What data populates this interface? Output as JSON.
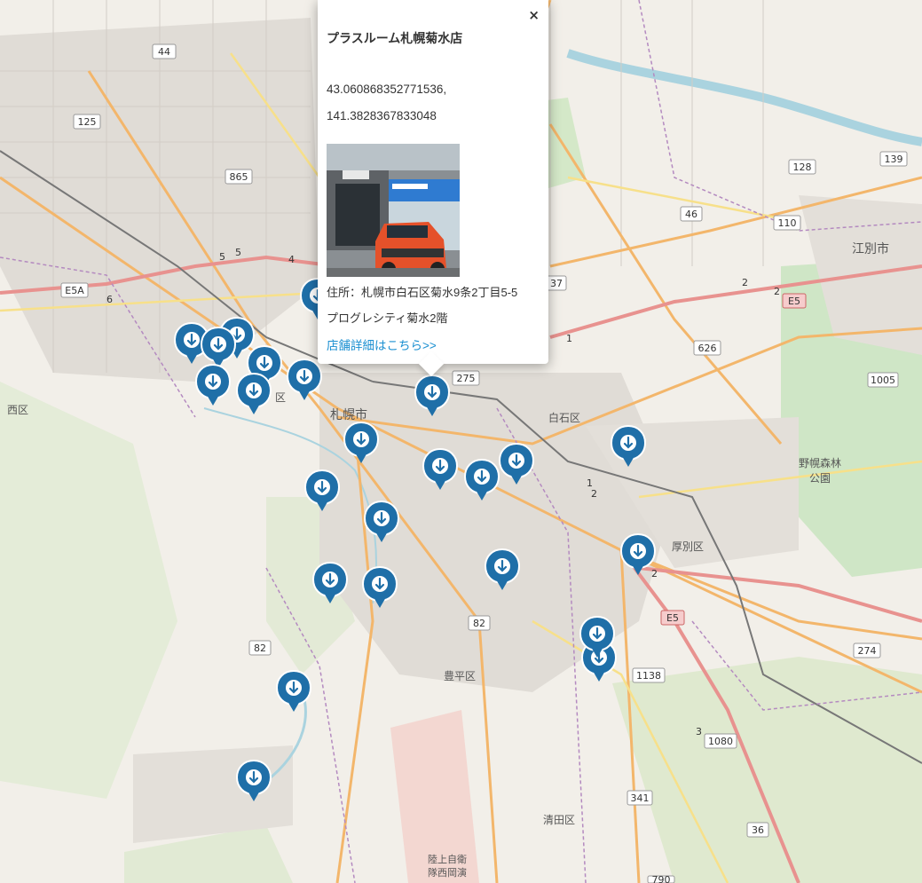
{
  "popup": {
    "title": "プラスルーム札幌菊水店",
    "lat": "43.060868352771536,",
    "lng": "141.3828367833048",
    "address_line1": "住所：札幌市白石区菊水9条2丁目5-5",
    "address_line2": "プログレシティ菊水2階",
    "link_text": "店舗詳細はこちら>>",
    "close_label": "×"
  },
  "map_labels": {
    "sapporo": "札幌市",
    "shiroishi": "白石区",
    "nishi": "西区",
    "ebetsu": "江別市",
    "nopporo1": "野幌森林",
    "nopporo2": "公園",
    "atsubetsu": "厚別区",
    "toyohira": "豊平区",
    "kiyota": "清田区",
    "jsdf1": "陸上自衛",
    "jsdf2": "隊西岡演",
    "chuo_partial": "区"
  },
  "road_shields": [
    "44",
    "125",
    "865",
    "E5A",
    "275",
    "82",
    "82",
    "626",
    "46",
    "110",
    "128",
    "139",
    "1005",
    "E5",
    "E5",
    "274",
    "1138",
    "1080",
    "341",
    "36",
    "37",
    "790"
  ],
  "road_numbers": [
    "5",
    "5",
    "4",
    "6",
    "2",
    "2",
    "1",
    "2",
    "3",
    "2",
    "1"
  ],
  "colors": {
    "marker": "#1f6fa8",
    "link": "#1a8fd1",
    "map_bg": "#f2efe9",
    "park": "#c8e6c0",
    "water": "#aad3df"
  }
}
